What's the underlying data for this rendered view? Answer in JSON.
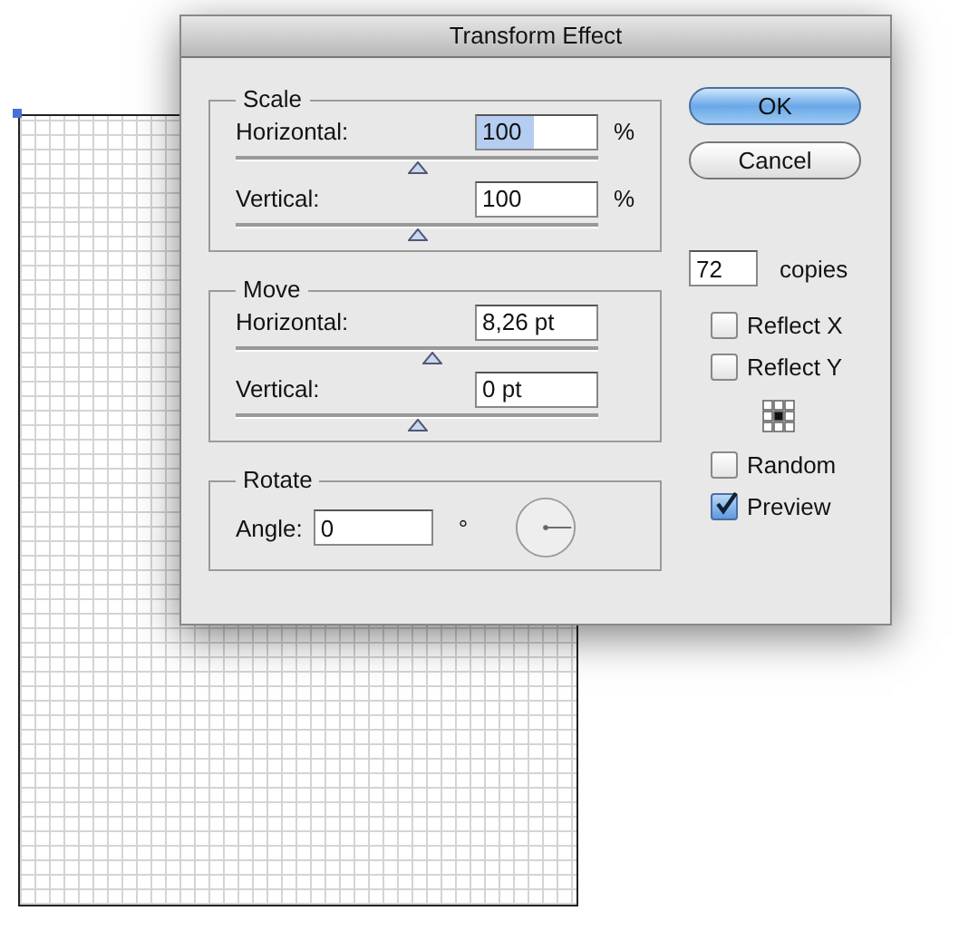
{
  "window": {
    "title": "Transform Effect"
  },
  "groups": [
    {
      "kind": "sliders",
      "title": "Scale",
      "rows": [
        {
          "label": "Horizontal:",
          "value": "100",
          "value_selected": true,
          "unit": "%",
          "level": 0.5
        },
        {
          "label": "Vertical:",
          "value": "100",
          "value_selected": false,
          "unit": "%",
          "level": 0.5
        }
      ]
    },
    {
      "kind": "sliders",
      "title": "Move",
      "rows": [
        {
          "label": "Horizontal:",
          "value": "8,26 pt",
          "value_selected": false,
          "level": 0.54
        },
        {
          "label": "Vertical:",
          "value": "0 pt",
          "value_selected": false,
          "level": 0.5
        }
      ]
    },
    {
      "kind": "angle",
      "title": "Rotate",
      "label": "Angle:",
      "value": "0",
      "unit": "°"
    }
  ],
  "buttons": [
    {
      "label": "OK",
      "default": true
    },
    {
      "label": "Cancel",
      "default": false
    }
  ],
  "copies": {
    "value": "72",
    "label": "copies"
  },
  "options": [
    {
      "kind": "checkbox",
      "label": "Reflect X",
      "checked": false
    },
    {
      "kind": "checkbox",
      "label": "Reflect Y",
      "checked": false
    },
    {
      "kind": "origin"
    },
    {
      "kind": "checkbox",
      "label": "Random",
      "checked": false
    },
    {
      "kind": "checkbox",
      "label": "Preview",
      "checked": true
    }
  ]
}
